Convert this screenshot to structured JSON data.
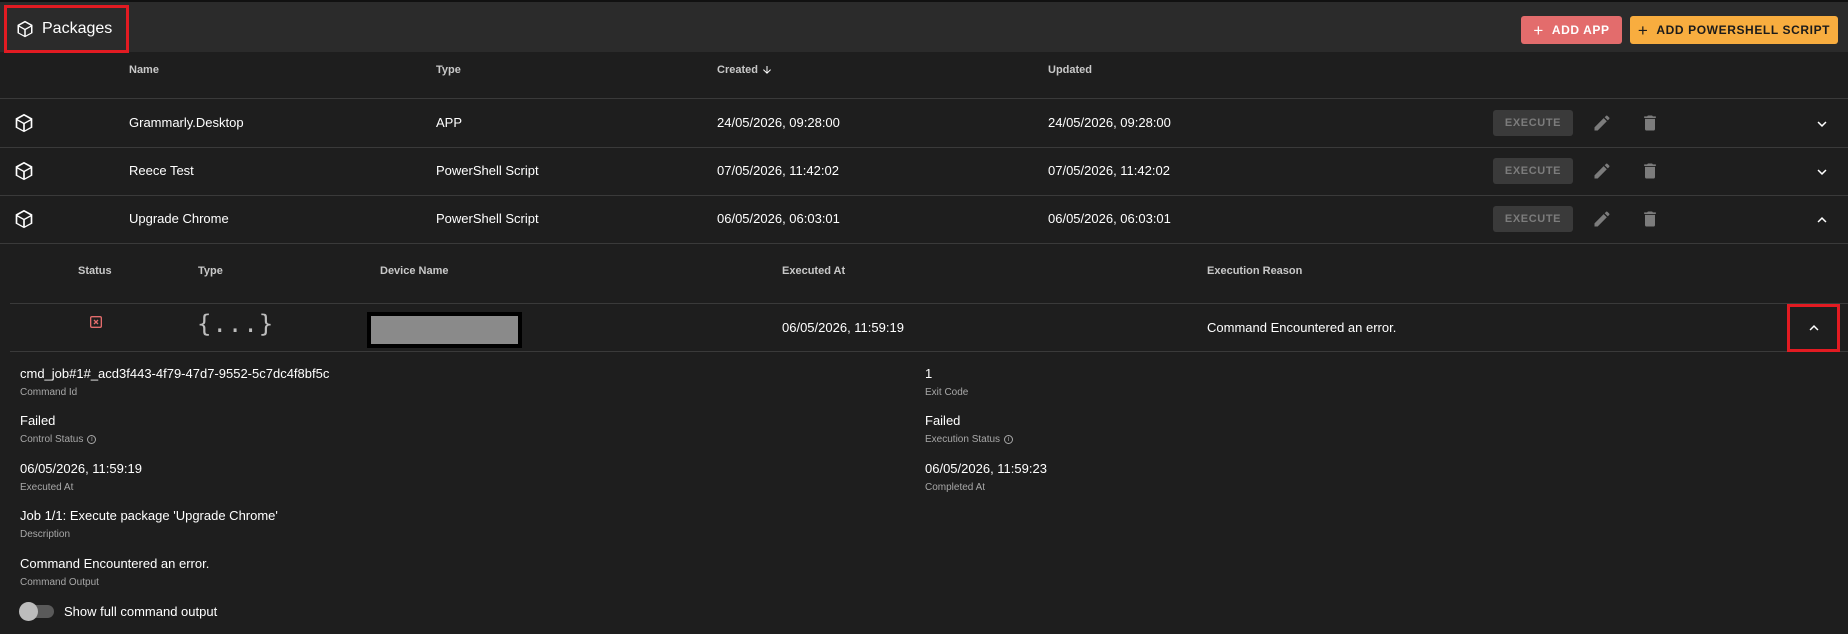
{
  "header": {
    "title": "Packages",
    "add_app_label": "ADD APP",
    "add_ps_label": "ADD POWERSHELL SCRIPT"
  },
  "table": {
    "columns": {
      "name": "Name",
      "type": "Type",
      "created": "Created",
      "updated": "Updated"
    },
    "sort": {
      "column": "Created",
      "direction": "descending"
    },
    "execute_label": "EXECUTE",
    "rows": [
      {
        "name": "Grammarly.Desktop",
        "type": "APP",
        "created": "24/05/2026, 09:28:00",
        "updated": "24/05/2026, 09:28:00",
        "expanded": false
      },
      {
        "name": "Reece Test",
        "type": "PowerShell Script",
        "created": "07/05/2026, 11:42:02",
        "updated": "07/05/2026, 11:42:02",
        "expanded": false
      },
      {
        "name": "Upgrade Chrome",
        "type": "PowerShell Script",
        "created": "06/05/2026, 06:03:01",
        "updated": "06/05/2026, 06:03:01",
        "expanded": true
      }
    ]
  },
  "executions": {
    "columns": {
      "status": "Status",
      "type": "Type",
      "device": "Device Name",
      "executed_at": "Executed At",
      "reason": "Execution Reason"
    },
    "rows": [
      {
        "status": "error",
        "type_glyph": "{...}",
        "device": "",
        "executed_at": "06/05/2026, 11:59:19",
        "reason": "Command Encountered an error."
      }
    ]
  },
  "details": {
    "command_id": {
      "value": "cmd_job#1#_acd3f443-4f79-47d7-9552-5c7dc4f8bf5c",
      "label": "Command Id"
    },
    "exit_code": {
      "value": "1",
      "label": "Exit Code"
    },
    "control_status": {
      "value": "Failed",
      "label": "Control Status"
    },
    "execution_status": {
      "value": "Failed",
      "label": "Execution Status"
    },
    "executed_at": {
      "value": "06/05/2026, 11:59:19",
      "label": "Executed At"
    },
    "completed_at": {
      "value": "06/05/2026, 11:59:23",
      "label": "Completed At"
    },
    "description": {
      "value": "Job 1/1: Execute package 'Upgrade Chrome'",
      "label": "Description"
    },
    "command_output": {
      "value": "Command Encountered an error.",
      "label": "Command Output"
    },
    "toggle_label": "Show full command output",
    "toggle_on": false
  },
  "colors": {
    "add_app": "#e36c6c",
    "add_ps": "#f8ad3f",
    "error": "#e36c6c",
    "highlight": "#e21b22"
  }
}
